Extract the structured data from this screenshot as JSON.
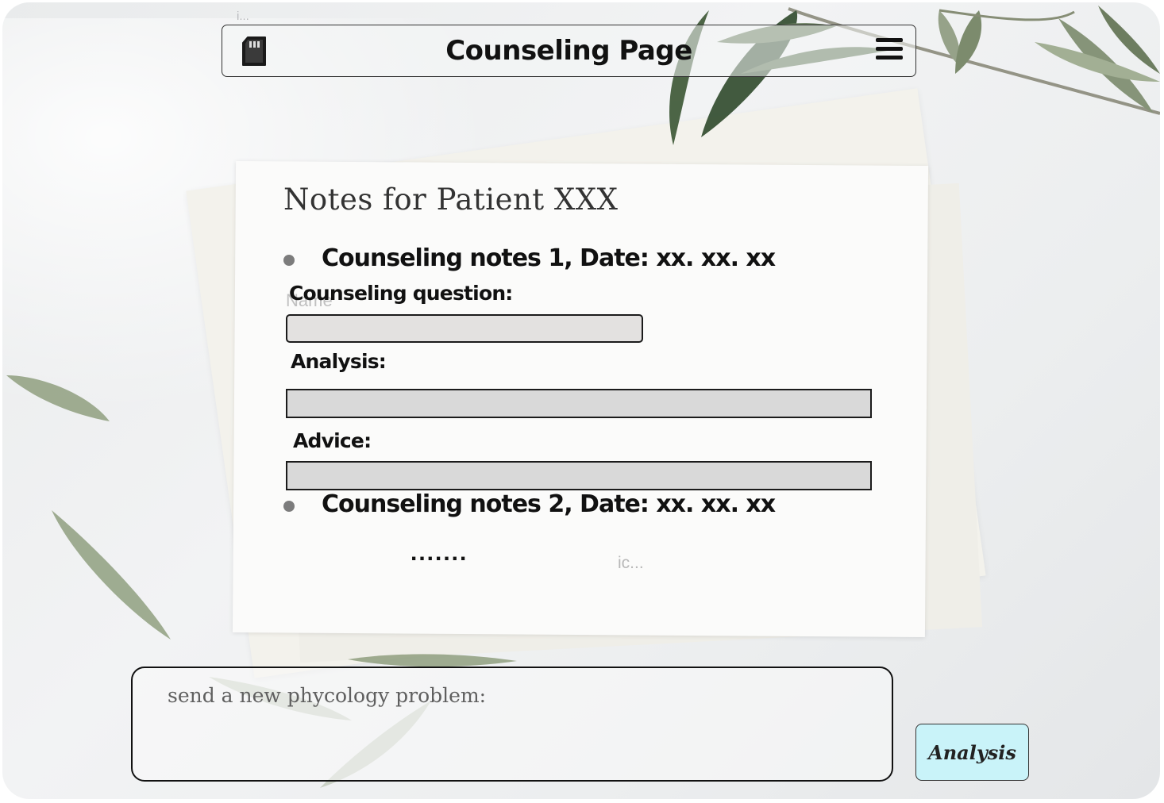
{
  "header": {
    "title": "Counseling Page",
    "left_icon": "sd-card-icon",
    "right_icon": "hamburger-menu-icon",
    "ghost_label": "i..."
  },
  "notes": {
    "title": "Notes for Patient XXX",
    "entries": [
      {
        "heading": "Counseling notes 1, Date: xx. xx. xx",
        "question_label": "Counseling question:",
        "question_ghost": "Name",
        "analysis_label": "Analysis:",
        "advice_label": "Advice:"
      },
      {
        "heading": "Counseling notes 2, Date: xx. xx. xx"
      }
    ],
    "ellipsis": ".......",
    "ghost_ic": "ic..."
  },
  "composer": {
    "placeholder": "send a new phycology problem:",
    "value": ""
  },
  "actions": {
    "analysis_label": "Analysis"
  },
  "colors": {
    "button_bg": "#c9f3f9",
    "field_bg": "#d9d9d9",
    "border": "#1b1b1b",
    "leaf": "#5e6b52"
  }
}
